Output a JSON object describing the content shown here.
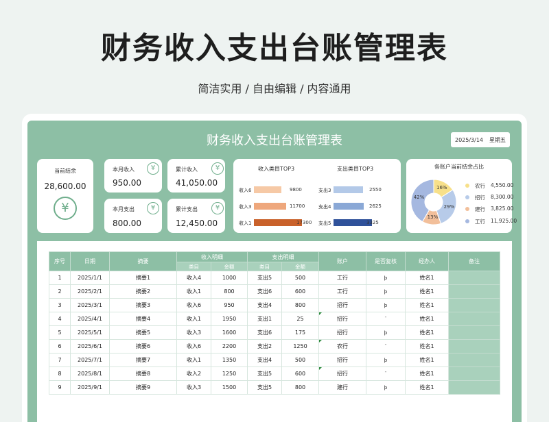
{
  "hero": {
    "title": "财务收入支出台账管理表",
    "subtitle": "简洁实用 / 自由编辑 / 内容通用"
  },
  "sheet": {
    "title": "财务收入支出台账管理表",
    "date": "2025/3/14",
    "weekday": "星期五"
  },
  "balance": {
    "label": "当前结余",
    "value": "28,600.00",
    "icon": "yen-icon"
  },
  "kpis": {
    "month_income": {
      "label": "本月收入",
      "value": "950.00"
    },
    "total_income": {
      "label": "累计收入",
      "value": "41,050.00"
    },
    "month_expense": {
      "label": "本月支出",
      "value": "800.00"
    },
    "total_expense": {
      "label": "累计支出",
      "value": "12,450.00"
    },
    "icon_glyph": "¥"
  },
  "top3": {
    "income_title": "收入类目TOP3",
    "expense_title": "支出类目TOP3",
    "income": [
      {
        "name": "收入6",
        "value": 9800,
        "label": "9800",
        "color": "#f6c9a6"
      },
      {
        "name": "收入3",
        "value": 11700,
        "label": "11700",
        "color": "#eea77c"
      },
      {
        "name": "收入1",
        "value": 17300,
        "label": "17300",
        "color": "#c9612a"
      }
    ],
    "expense": [
      {
        "name": "支出3",
        "value": 2550,
        "label": "2550",
        "color": "#b3c9e8"
      },
      {
        "name": "支出4",
        "value": 2625,
        "label": "2625",
        "color": "#8aa8d6"
      },
      {
        "name": "支出5",
        "value": 3325,
        "label": "3325",
        "color": "#2f519a"
      }
    ]
  },
  "chart_data": {
    "type": "pie",
    "title": "各账户当前结余占比",
    "slices": [
      {
        "name": "农行",
        "value": 4550,
        "label": "4,550.00",
        "percent": "16%",
        "color": "#f7e08a"
      },
      {
        "name": "招行",
        "value": 8300,
        "label": "8,300.00",
        "percent": "29%",
        "color": "#b7cbe9"
      },
      {
        "name": "建行",
        "value": 3825,
        "label": "3,825.00",
        "percent": "13%",
        "color": "#f2bf9a"
      },
      {
        "name": "工行",
        "value": 11925,
        "label": "11,925.00",
        "percent": "42%",
        "color": "#a5b8e0"
      }
    ]
  },
  "table": {
    "headers": {
      "seq": "序号",
      "date": "日期",
      "summary": "摘要",
      "income_group": "收入明细",
      "expense_group": "支出明细",
      "category": "类目",
      "amount": "金额",
      "account": "账户",
      "audited": "是否复核",
      "handler": "经办人",
      "remark": "备注"
    },
    "rows": [
      {
        "seq": "1",
        "date": "2025/1/1",
        "summary": "摘要1",
        "in_cat": "收入4",
        "in_amt": "1000",
        "out_cat": "支出5",
        "out_amt": "500",
        "account": "工行",
        "audited": "þ",
        "tick": false,
        "handler": "姓名1"
      },
      {
        "seq": "2",
        "date": "2025/2/1",
        "summary": "摘要2",
        "in_cat": "收入1",
        "in_amt": "800",
        "out_cat": "支出6",
        "out_amt": "600",
        "account": "工行",
        "audited": "þ",
        "tick": false,
        "handler": "姓名1"
      },
      {
        "seq": "3",
        "date": "2025/3/1",
        "summary": "摘要3",
        "in_cat": "收入6",
        "in_amt": "950",
        "out_cat": "支出4",
        "out_amt": "800",
        "account": "招行",
        "audited": "þ",
        "tick": false,
        "handler": "姓名1"
      },
      {
        "seq": "4",
        "date": "2025/4/1",
        "summary": "摘要4",
        "in_cat": "收入1",
        "in_amt": "1950",
        "out_cat": "支出1",
        "out_amt": "25",
        "account": "招行",
        "audited": "¨",
        "tick": true,
        "handler": "姓名1"
      },
      {
        "seq": "5",
        "date": "2025/5/1",
        "summary": "摘要5",
        "in_cat": "收入3",
        "in_amt": "1600",
        "out_cat": "支出6",
        "out_amt": "175",
        "account": "招行",
        "audited": "þ",
        "tick": false,
        "handler": "姓名1"
      },
      {
        "seq": "6",
        "date": "2025/6/1",
        "summary": "摘要6",
        "in_cat": "收入6",
        "in_amt": "2200",
        "out_cat": "支出2",
        "out_amt": "1250",
        "account": "农行",
        "audited": "¨",
        "tick": true,
        "handler": "姓名1"
      },
      {
        "seq": "7",
        "date": "2025/7/1",
        "summary": "摘要7",
        "in_cat": "收入1",
        "in_amt": "1350",
        "out_cat": "支出4",
        "out_amt": "500",
        "account": "招行",
        "audited": "þ",
        "tick": false,
        "handler": "姓名1"
      },
      {
        "seq": "8",
        "date": "2025/8/1",
        "summary": "摘要8",
        "in_cat": "收入2",
        "in_amt": "1250",
        "out_cat": "支出5",
        "out_amt": "600",
        "account": "招行",
        "audited": "¨",
        "tick": true,
        "handler": "姓名1"
      },
      {
        "seq": "9",
        "date": "2025/9/1",
        "summary": "摘要9",
        "in_cat": "收入3",
        "in_amt": "1500",
        "out_cat": "支出5",
        "out_amt": "800",
        "account": "建行",
        "audited": "þ",
        "tick": false,
        "handler": "姓名1"
      }
    ]
  }
}
